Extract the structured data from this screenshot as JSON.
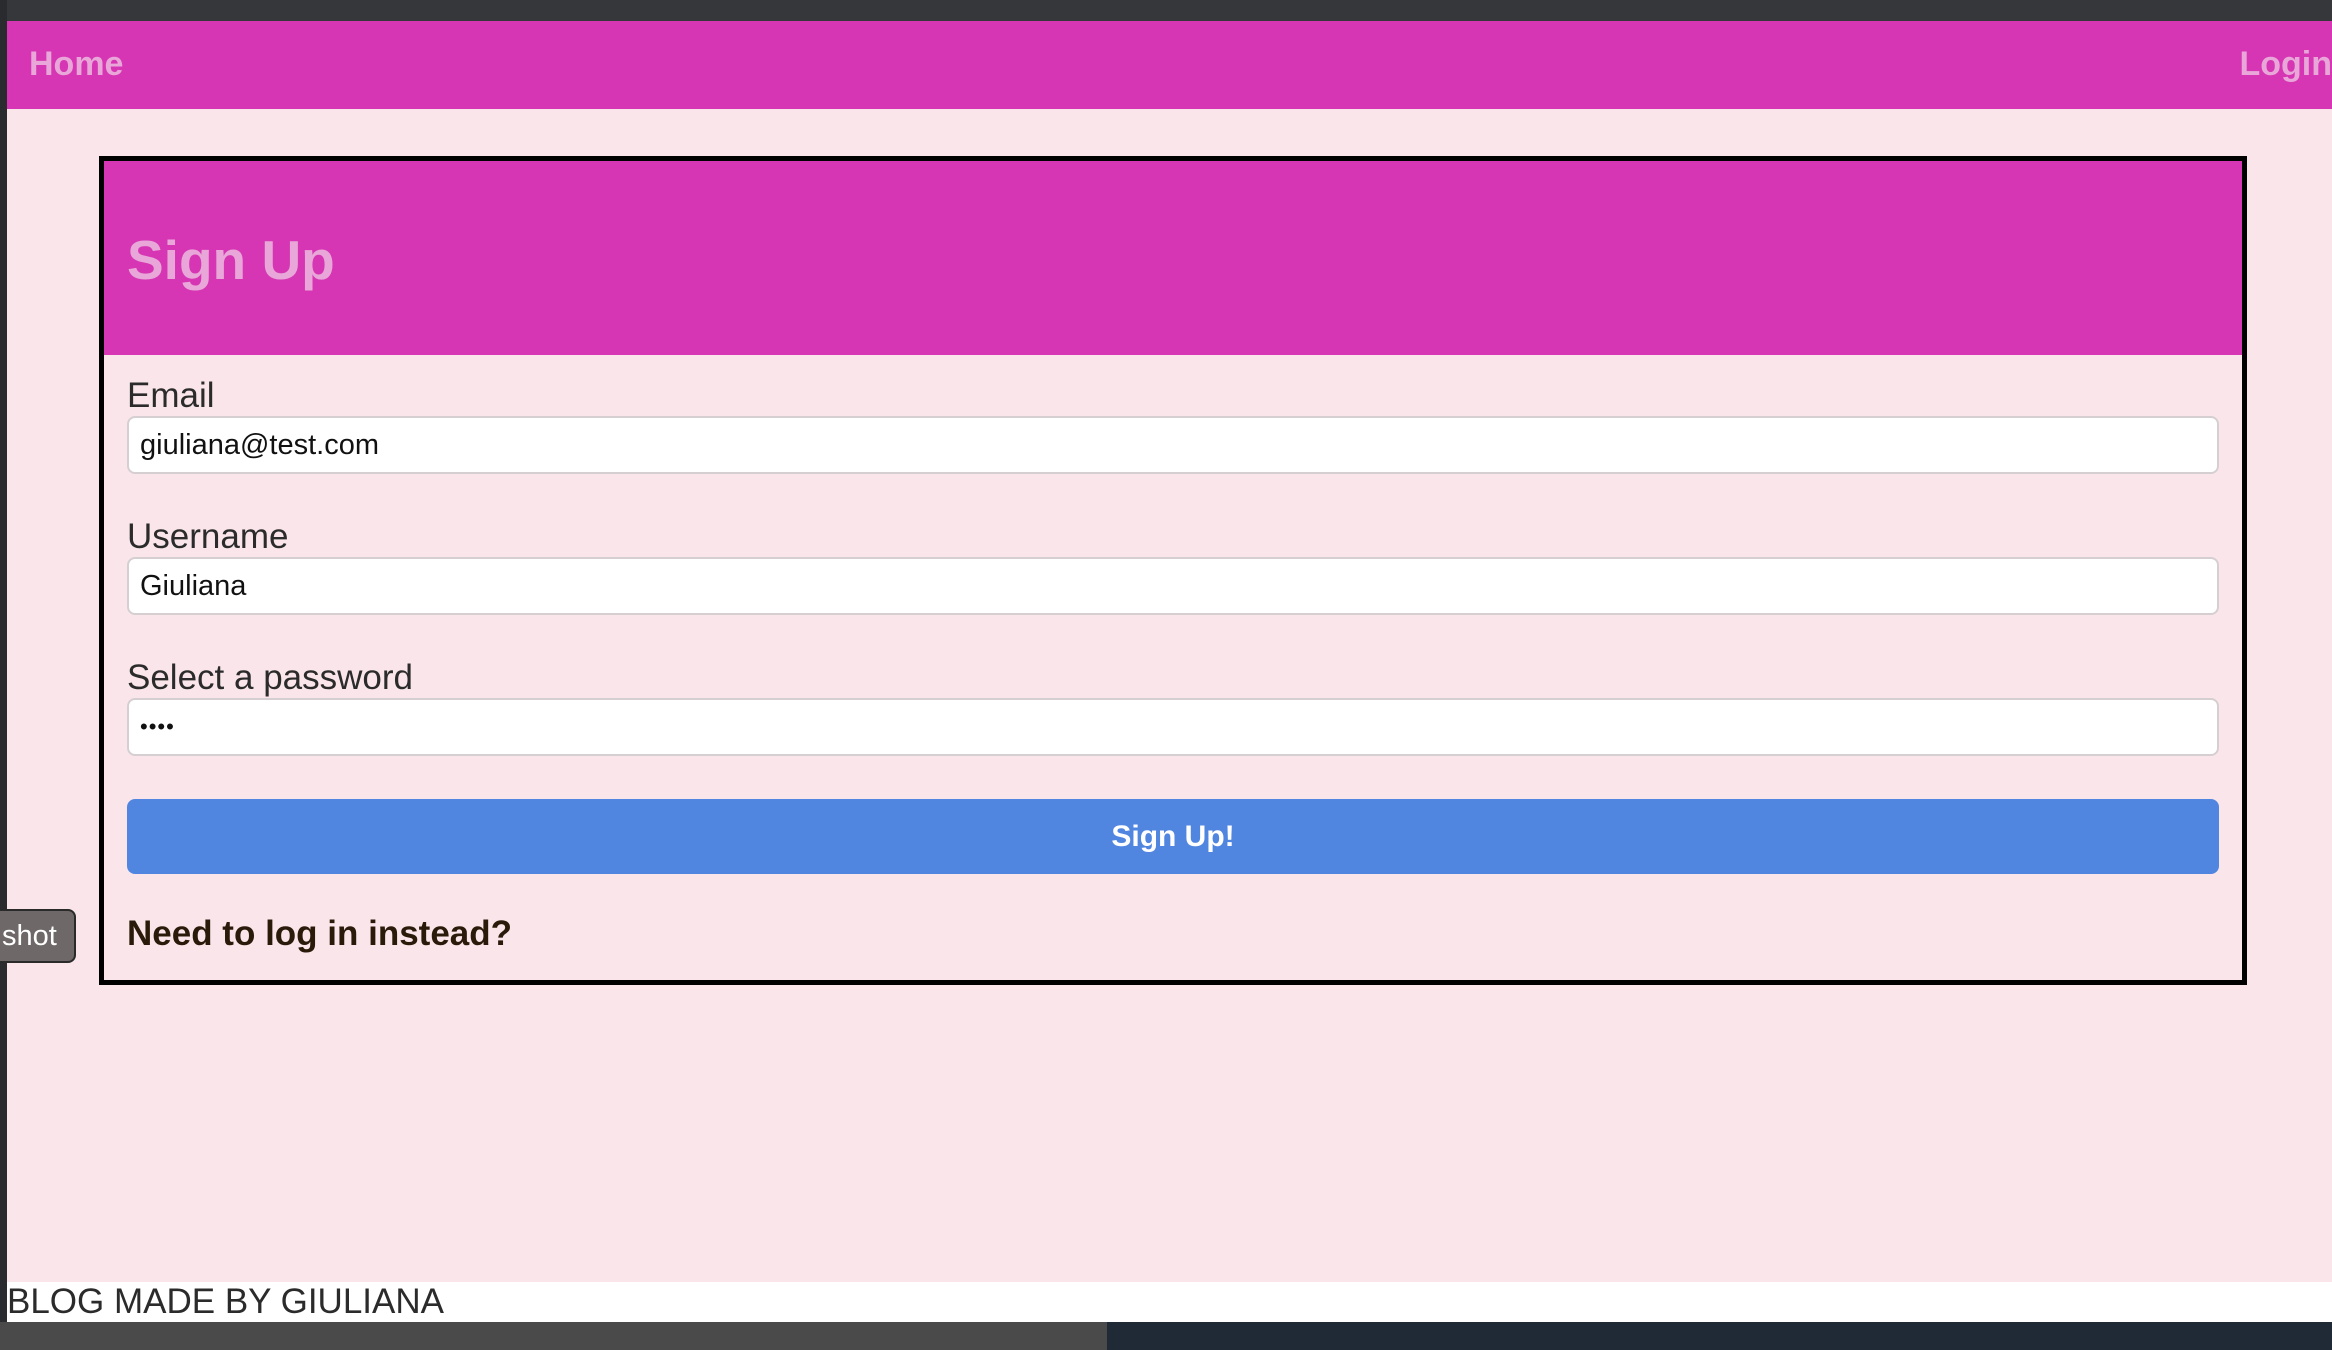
{
  "navbar": {
    "home_label": "Home",
    "login_label": "Login"
  },
  "signup_card": {
    "title": "Sign Up",
    "email_label": "Email",
    "email_value": "giuliana@test.com",
    "username_label": "Username",
    "username_value": "Giuliana",
    "password_label": "Select a password",
    "password_value": "••••",
    "submit_label": "Sign Up!",
    "login_instead_label": "Need to log in instead?"
  },
  "footer": {
    "text": "BLOG MADE BY GIULIANA"
  },
  "overlay": {
    "screenshot_tag": "shot"
  },
  "colors": {
    "nav_bg": "#d636b3",
    "nav_text": "#e9a6d8",
    "page_bg": "#fae6ea",
    "button_bg": "#5186e0"
  }
}
